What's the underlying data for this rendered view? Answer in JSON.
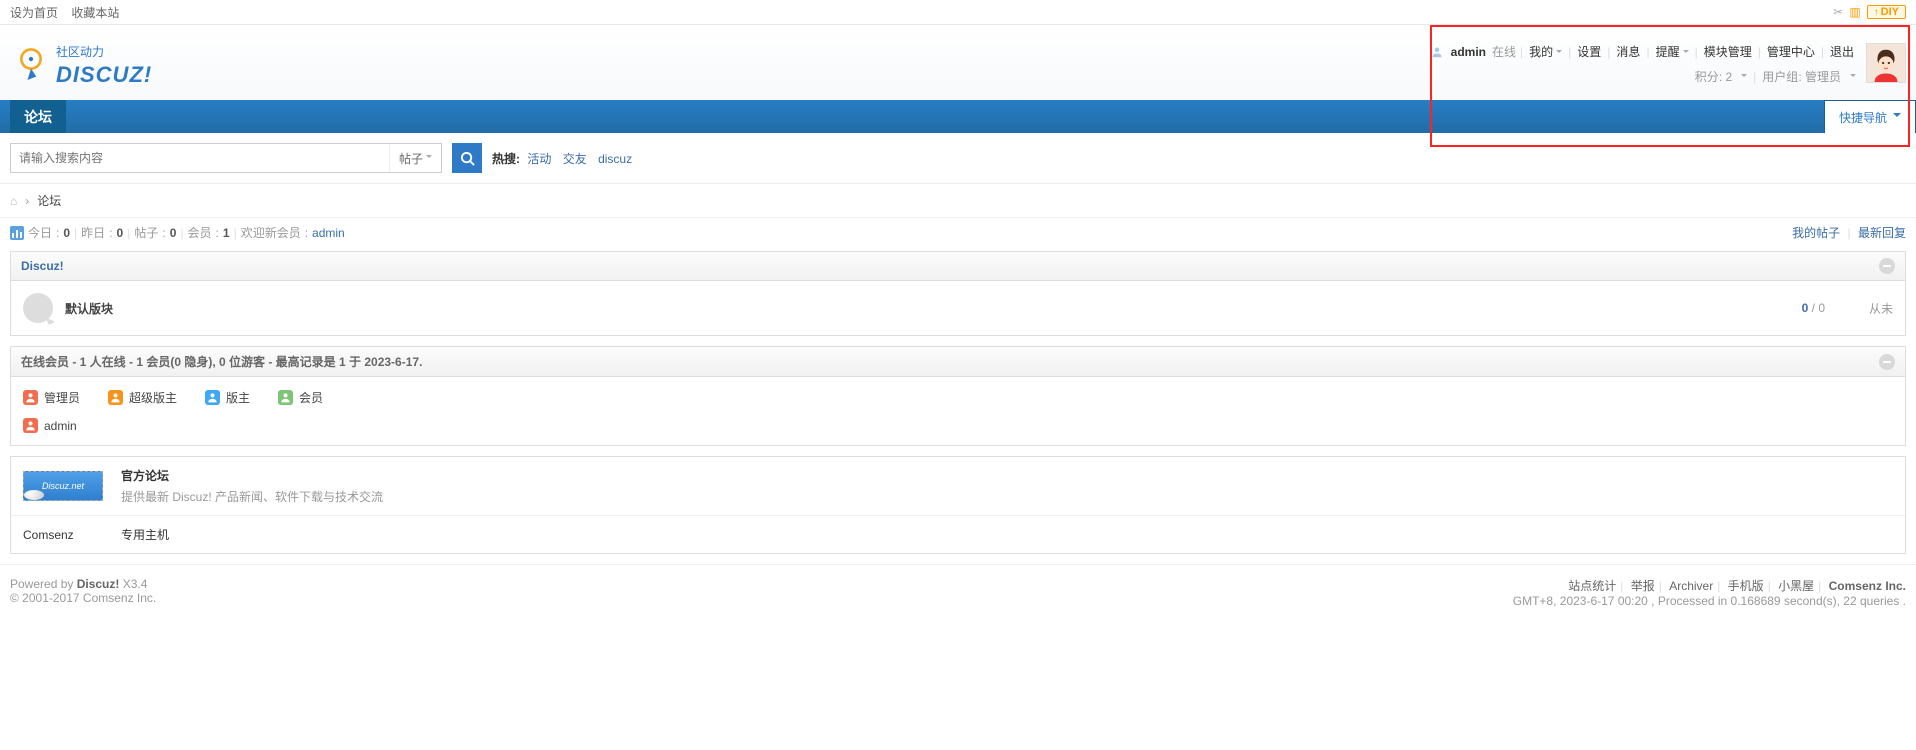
{
  "topbar": {
    "set_home": "设为首页",
    "favorite": "收藏本站",
    "diy": "DIY"
  },
  "logo": {
    "cn": "社区动力",
    "en": "DISCUZ!"
  },
  "user": {
    "name": "admin",
    "status": "在线",
    "my": "我的",
    "settings": "设置",
    "messages": "消息",
    "notify": "提醒",
    "module_mgmt": "模块管理",
    "admin_cp": "管理中心",
    "logout": "退出",
    "points_label": "积分",
    "points": "2",
    "group_label": "用户组",
    "group": "管理员"
  },
  "nav": {
    "forum": "论坛",
    "quick": "快捷导航"
  },
  "search": {
    "placeholder": "请输入搜索内容",
    "type": "帖子",
    "hot_label": "热搜:",
    "hot1": "活动",
    "hot2": "交友",
    "hot3": "discuz"
  },
  "crumb": {
    "forum": "论坛"
  },
  "stats": {
    "today": "今日",
    "today_n": "0",
    "yesterday": "昨日",
    "yesterday_n": "0",
    "posts": "帖子",
    "posts_n": "0",
    "members": "会员",
    "members_n": "1",
    "welcome": "欢迎新会员",
    "welcome_name": "admin",
    "my_posts": "我的帖子",
    "latest": "最新回复"
  },
  "category": {
    "name": "Discuz!"
  },
  "forum": {
    "name": "默认版块",
    "threads": "0",
    "replies": "0",
    "last": "从未"
  },
  "online": {
    "title": "在线会员 - 1 人在线 - 1 会员(0 隐身), 0 位游客 - 最高记录是 1 于 2023-6-17.",
    "admin": "管理员",
    "smod": "超级版主",
    "mod": "版主",
    "member": "会员",
    "user1": "admin"
  },
  "links": {
    "official_t": "官方论坛",
    "official_d": "提供最新 Discuz! 产品新闻、软件下载与技术交流",
    "comsenz": "Comsenz",
    "host": "专用主机",
    "imgtext": "Discuz.net"
  },
  "footer": {
    "powered": "Powered by ",
    "product": "Discuz!",
    "ver": " X3.4",
    "copyright": "© 2001-2017 Comsenz Inc.",
    "stats": "站点统计",
    "report": "举报",
    "archiver": "Archiver",
    "mobile": "手机版",
    "dark": "小黑屋",
    "company": "Comsenz Inc.",
    "time": "GMT+8, 2023-6-17 00:20 , Processed in 0.168689 second(s), 22 queries ."
  }
}
